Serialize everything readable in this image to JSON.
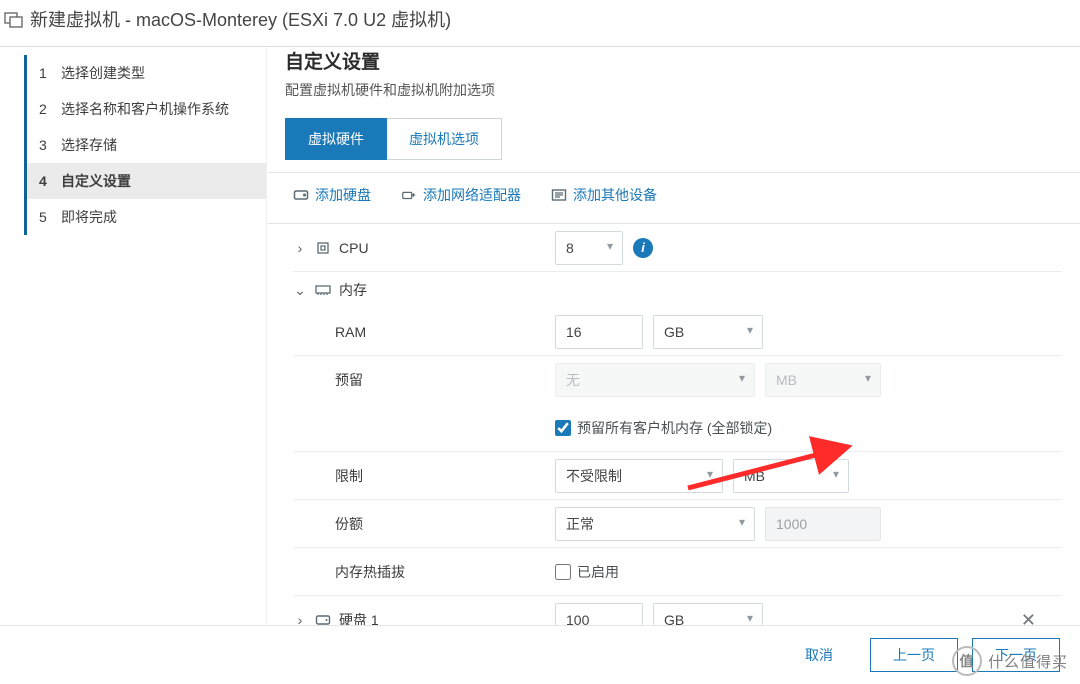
{
  "header": {
    "title": "新建虚拟机 - macOS-Monterey (ESXi 7.0 U2 虚拟机)"
  },
  "sidebar": {
    "items": [
      {
        "num": "1",
        "label": "选择创建类型"
      },
      {
        "num": "2",
        "label": "选择名称和客户机操作系统"
      },
      {
        "num": "3",
        "label": "选择存储"
      },
      {
        "num": "4",
        "label": "自定义设置"
      },
      {
        "num": "5",
        "label": "即将完成"
      }
    ],
    "active_index": 3
  },
  "content": {
    "title": "自定义设置",
    "subtitle": "配置虚拟机硬件和虚拟机附加选项"
  },
  "tabs": {
    "hardware": "虚拟硬件",
    "options": "虚拟机选项",
    "active": 0
  },
  "toolbar": {
    "add_disk": "添加硬盘",
    "add_nic": "添加网络适配器",
    "add_other": "添加其他设备"
  },
  "form": {
    "cpu": {
      "label": "CPU",
      "value": "8"
    },
    "memory_group": "内存",
    "ram": {
      "label": "RAM",
      "value": "16",
      "unit": "GB"
    },
    "reservation": {
      "label": "预留",
      "value": "无",
      "unit": "MB"
    },
    "reserve_all": {
      "label": "预留所有客户机内存 (全部锁定)",
      "checked": true
    },
    "limit": {
      "label": "限制",
      "value": "不受限制",
      "unit": "MB"
    },
    "shares": {
      "label": "份额",
      "value": "正常",
      "number": "1000"
    },
    "hotplug": {
      "label": "内存热插拔",
      "enabled_label": "已启用",
      "checked": false
    },
    "disk1": {
      "label": "硬盘 1",
      "value": "100",
      "unit": "GB"
    }
  },
  "footer": {
    "cancel": "取消",
    "prev": "上一页",
    "next": "下一页"
  },
  "watermark": {
    "badge": "值",
    "text": "什么值得买"
  }
}
